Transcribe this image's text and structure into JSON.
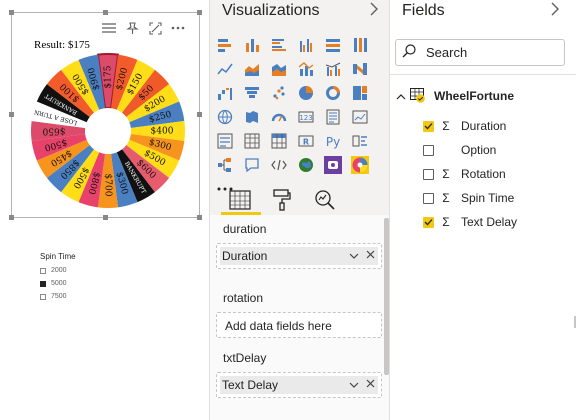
{
  "visual": {
    "result_text": "Result: $175",
    "wheel_labels": [
      "$175",
      "$200",
      "$150",
      "$50",
      "$200",
      "$250",
      "$400",
      "$300",
      "$500",
      "$600",
      "BANKRUPT",
      "$300",
      "$700",
      "$800",
      "$500",
      "$850",
      "$450",
      "$500",
      "$650",
      "LOSE A TURN",
      "BANKRUPT",
      "$100",
      "$500",
      "$900"
    ],
    "wheel_colors": [
      "#dd4b6b",
      "#f45b2a",
      "#ffde17",
      "#f05a28",
      "#ffde17",
      "#4a7fc1",
      "#ffde17",
      "#f7941d",
      "#ffde17",
      "#e65c6c",
      "#111111",
      "#4a7fc1",
      "#f7941d",
      "#e8416a",
      "#ffde17",
      "#4a7fc1",
      "#f7941d",
      "#e8416a",
      "#dd4b6b",
      "#ffffff",
      "#111111",
      "#f45b2a",
      "#ffde17",
      "#4a7fc1"
    ]
  },
  "slicer": {
    "title": "Spin Time",
    "options": [
      {
        "label": "2000",
        "checked": false
      },
      {
        "label": "5000",
        "checked": true
      },
      {
        "label": "7500",
        "checked": false
      }
    ]
  },
  "visualizations": {
    "title": "Visualizations",
    "wells": [
      {
        "label": "duration",
        "field": "Duration"
      },
      {
        "label": "rotation",
        "placeholder": "Add data fields here"
      },
      {
        "label": "txtDelay",
        "field": "Text Delay"
      }
    ]
  },
  "fields": {
    "title": "Fields",
    "search_placeholder": "Search",
    "table": "WheelFortune",
    "items": [
      {
        "label": "Duration",
        "checked": true,
        "sigma": "Σ"
      },
      {
        "label": "Option",
        "checked": false,
        "sigma": ""
      },
      {
        "label": "Rotation",
        "checked": false,
        "sigma": "Σ"
      },
      {
        "label": "Spin Time",
        "checked": false,
        "sigma": "Σ"
      },
      {
        "label": "Text Delay",
        "checked": true,
        "sigma": "Σ"
      }
    ]
  }
}
